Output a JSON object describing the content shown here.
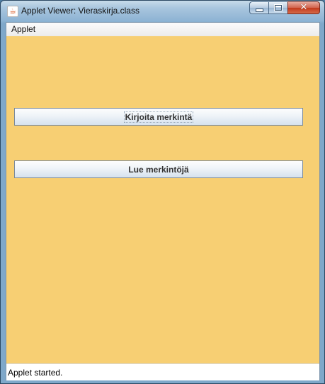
{
  "window": {
    "title": "Applet Viewer: Vieraskirja.class",
    "icon": "java-cup-icon",
    "icon_glyph": "☕",
    "controls": {
      "minimize_icon": "minimize-icon",
      "maximize_icon": "maximize-icon",
      "close_icon": "close-icon",
      "close_glyph": "✕"
    }
  },
  "menubar": {
    "items": [
      {
        "label": "Applet"
      }
    ]
  },
  "applet": {
    "background_color": "#f7cf73",
    "buttons": [
      {
        "label": "Kirjoita merkintä",
        "focused": true
      },
      {
        "label": "Lue merkintöjä",
        "focused": false
      }
    ]
  },
  "statusbar": {
    "text": "Applet started."
  }
}
